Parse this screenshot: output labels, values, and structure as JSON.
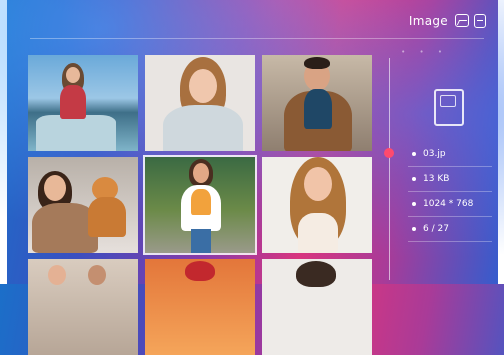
{
  "header": {
    "title": "Image",
    "icons": [
      "gallery-icon",
      "sd-card-icon"
    ]
  },
  "grid": {
    "selected_index": 4,
    "thumbnails": [
      {
        "name": "thumb-woman-car"
      },
      {
        "name": "thumb-woman-smiling"
      },
      {
        "name": "thumb-man-scarf"
      },
      {
        "name": "thumb-woman-cat"
      },
      {
        "name": "thumb-woman-sunglasses"
      },
      {
        "name": "thumb-woman-hair"
      },
      {
        "name": "thumb-row3-1"
      },
      {
        "name": "thumb-row3-2"
      },
      {
        "name": "thumb-row3-3"
      }
    ]
  },
  "details": {
    "filename": "03.jp",
    "size": "13 KB",
    "resolution": "1024 * 768",
    "position": "6 / 27",
    "storage_icon": "sd-card-icon"
  },
  "colors": {
    "accent": "#ff4a6e"
  }
}
